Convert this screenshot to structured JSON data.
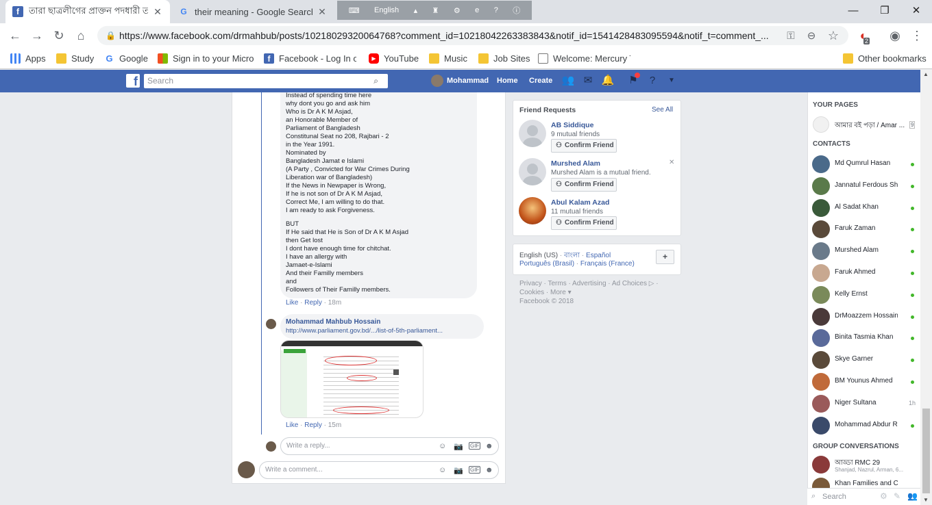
{
  "browser": {
    "tabs": [
      {
        "title": "তারা ছাত্রলীগের প্রাক্তন পদধারী তা",
        "icon": "facebook-icon",
        "active": true
      },
      {
        "title": "their meaning - Google Search",
        "icon": "google-icon",
        "active": false
      }
    ],
    "language_bar_label": "English",
    "url": "https://www.facebook.com/drmahbub/posts/10218029320064768?comment_id=10218042263383843&notif_id=1541428483095594&notif_t=comment_...",
    "extension_badge": "2",
    "bookmarks": [
      {
        "label": "Apps",
        "icon": "apps-grid-icon"
      },
      {
        "label": "Study",
        "icon": "folder-icon"
      },
      {
        "label": "Google",
        "icon": "google-icon"
      },
      {
        "label": "Sign in to your Micro",
        "icon": "microsoft-icon"
      },
      {
        "label": "Facebook - Log In or",
        "icon": "facebook-icon"
      },
      {
        "label": "YouTube",
        "icon": "youtube-icon"
      },
      {
        "label": "Music",
        "icon": "folder-icon"
      },
      {
        "label": "Job Sites",
        "icon": "folder-icon"
      },
      {
        "label": "Welcome: Mercury To",
        "icon": "page-icon"
      }
    ],
    "other_bookmarks": "Other bookmarks"
  },
  "fb_header": {
    "search_placeholder": "Search",
    "profile_name": "Mohammad",
    "nav_home": "Home",
    "nav_create": "Create"
  },
  "comment": {
    "lines_a": [
      "Instead of spending time here",
      "why dont you go and ask him",
      "Who is Dr A K M Asjad,",
      "an Honorable Member of",
      "Parliament of Bangladesh",
      "Constitunal Seat no 208, Rajbari - 2",
      "in the Year 1991.",
      "Nominated by",
      "Bangladesh Jamat e Islami",
      "(A Party , Convicted for War Crimes During",
      "Liberation war of Bangladesh)",
      "If the News in Newpaper is Wrong,",
      "If he is not son of Dr A K M Asjad,",
      "Correct Me, I am willing to do that.",
      "I am ready to ask Forgiveness."
    ],
    "lines_b": [
      "BUT",
      "If He said that He is Son of Dr A K M Asjad",
      "then Get lost",
      "I dont have enough time for chitchat.",
      "I have an allergy with",
      "Jamaet-e-Islami",
      "And their Familly members",
      "and",
      "Followers of Their Familly members."
    ],
    "like": "Like",
    "reply": "Reply",
    "time": "18m"
  },
  "reply": {
    "author": "Mohammad Mahbub Hossain",
    "link": "http://www.parliament.gov.bd/.../list-of-5th-parliament...",
    "like": "Like",
    "reply": "Reply",
    "time": "15m"
  },
  "reply_box_placeholder": "Write a reply...",
  "comment_box_placeholder": "Write a comment...",
  "friend_requests": {
    "title": "Friend Requests",
    "see_all": "See All",
    "confirm_label": "Confirm Friend",
    "items": [
      {
        "name": "AB Siddique",
        "sub": "9 mutual friends"
      },
      {
        "name": "Murshed Alam",
        "sub": "Murshed Alam is a mutual friend."
      },
      {
        "name": "Abul Kalam Azad",
        "sub": "11 mutual friends"
      }
    ]
  },
  "languages": {
    "line1": [
      "English (US)",
      "বাংলা",
      "Español"
    ],
    "line2": [
      "Português (Brasil)",
      "Français (France)"
    ],
    "add": "+"
  },
  "footer": {
    "line1": "Privacy · Terms · Advertising · Ad Choices ▷ ·",
    "line2": "Cookies · More ▾",
    "line3": "Facebook © 2018"
  },
  "chat": {
    "your_pages": "YOUR PAGES",
    "page_name": "আমার বই পড়া / Amar ...",
    "page_count": "9",
    "contacts_title": "CONTACTS",
    "contacts": [
      {
        "name": "Md Qumrul Hasan",
        "status": "online"
      },
      {
        "name": "Jannatul Ferdous Sh...",
        "status": "online"
      },
      {
        "name": "Al Sadat Khan",
        "status": "online"
      },
      {
        "name": "Faruk Zaman",
        "status": "online"
      },
      {
        "name": "Murshed Alam",
        "status": "online"
      },
      {
        "name": "Faruk Ahmed",
        "status": "online"
      },
      {
        "name": "Kelly Ernst",
        "status": "online"
      },
      {
        "name": "DrMoazzem Hossain ...",
        "status": "online"
      },
      {
        "name": "Binita Tasmia Khan",
        "status": "online"
      },
      {
        "name": "Skye Garner",
        "status": "online"
      },
      {
        "name": "BM Younus Ahmed",
        "status": "online"
      },
      {
        "name": "Niger Sultana",
        "status": "1h"
      },
      {
        "name": "Mohammad Abdur R...",
        "status": "online"
      }
    ],
    "group_title": "GROUP CONVERSATIONS",
    "groups": [
      {
        "name": "আড্ডা RMC 29",
        "members": "Shanjad, Nazrul, Arman, 6..."
      },
      {
        "name": "Khan Families and Co",
        "members": ""
      }
    ],
    "search_placeholder": "Search"
  }
}
